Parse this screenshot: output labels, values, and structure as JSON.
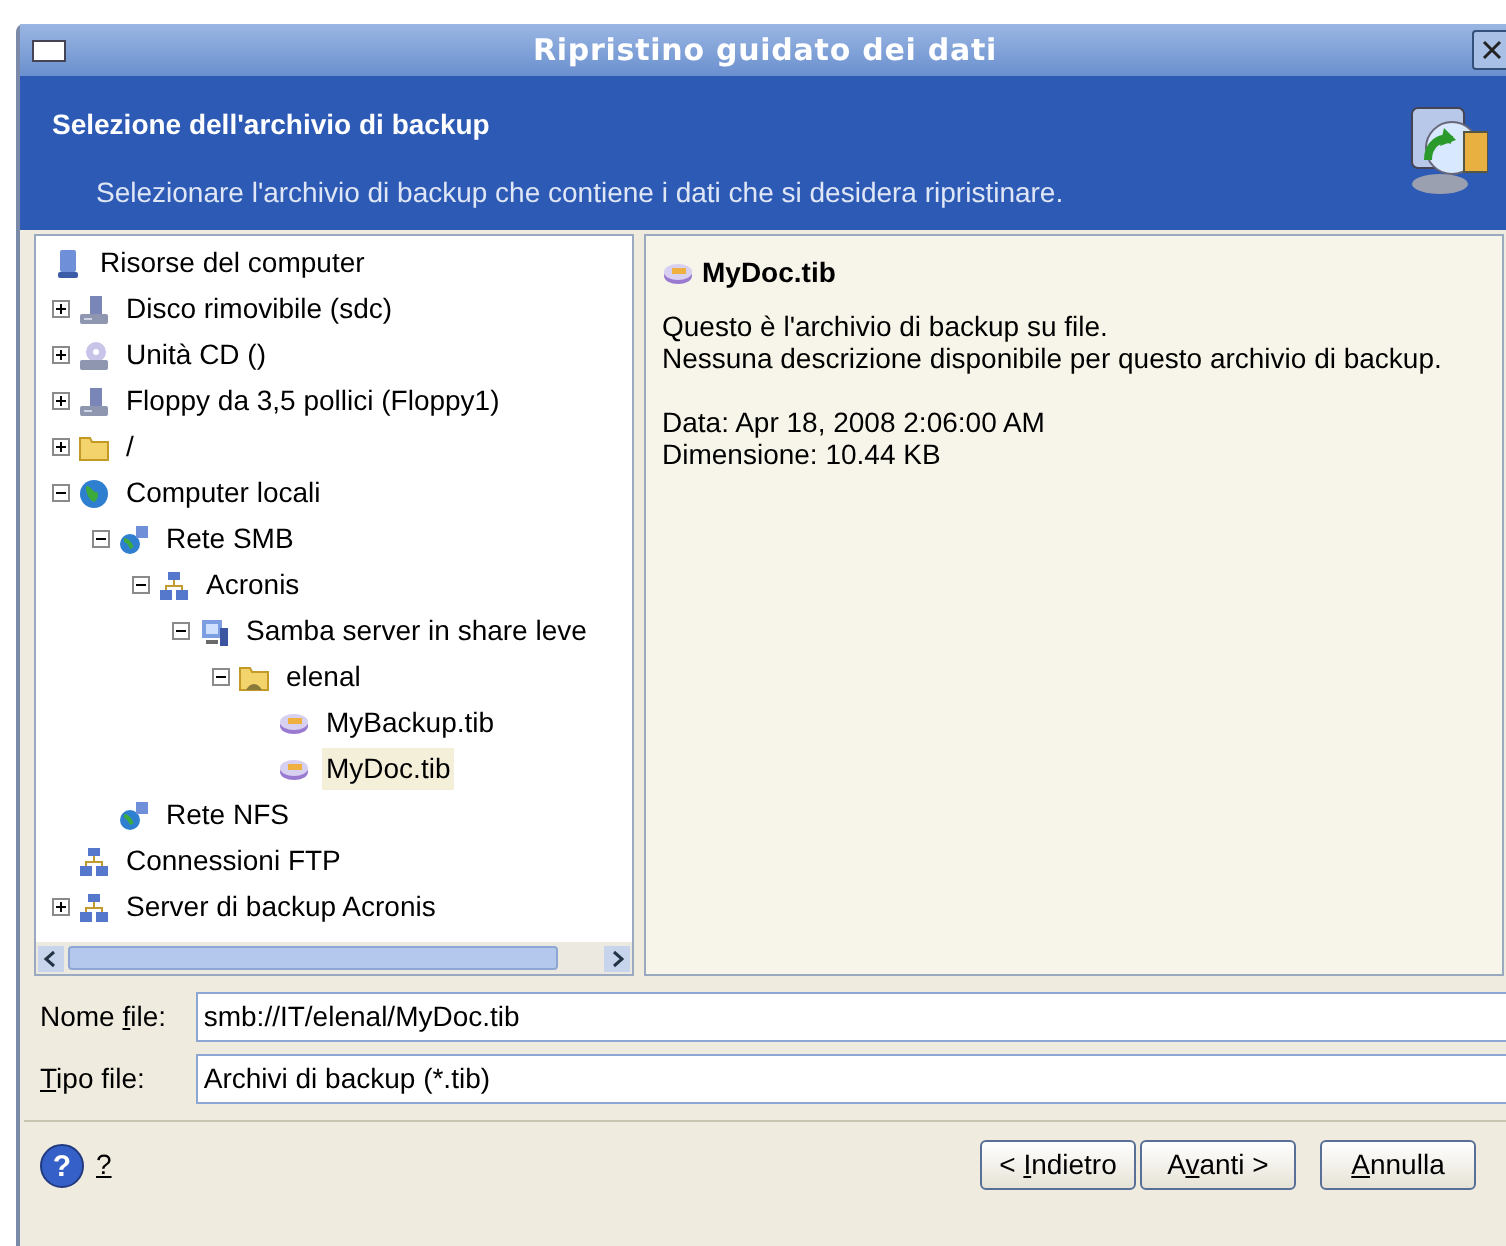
{
  "window": {
    "title": "Ripristino guidato dei dati"
  },
  "header": {
    "title": "Selezione dell'archivio di backup",
    "subtitle": "Selezionare l'archivio di backup che contiene i dati che si desidera ripristinare."
  },
  "tree": {
    "root": {
      "label": "Risorse del computer",
      "kind": "computer",
      "selected": false,
      "children": [
        {
          "label": "Disco rimovibile (sdc)",
          "kind": "drive",
          "expanded": false,
          "selected": false
        },
        {
          "label": "Unità CD ()",
          "kind": "cd",
          "expanded": false,
          "selected": false
        },
        {
          "label": "Floppy da 3,5 pollici (Floppy1)",
          "kind": "drive",
          "expanded": false,
          "selected": false
        },
        {
          "label": "/",
          "kind": "folder",
          "expanded": false,
          "selected": false
        },
        {
          "label": "Computer locali",
          "kind": "globe",
          "expanded": true,
          "selected": false,
          "children": [
            {
              "label": "Rete SMB",
              "kind": "network",
              "expanded": true,
              "selected": false,
              "children": [
                {
                  "label": "Acronis",
                  "kind": "group",
                  "expanded": true,
                  "selected": false,
                  "children": [
                    {
                      "label": "Samba server in share leve",
                      "kind": "server",
                      "expanded": true,
                      "selected": false,
                      "children": [
                        {
                          "label": "elenal",
                          "kind": "share",
                          "expanded": true,
                          "selected": false,
                          "children": [
                            {
                              "label": "MyBackup.tib",
                              "kind": "archive",
                              "selected": false
                            },
                            {
                              "label": "MyDoc.tib",
                              "kind": "archive",
                              "selected": true
                            }
                          ]
                        }
                      ]
                    }
                  ]
                }
              ]
            },
            {
              "label": "Rete NFS",
              "kind": "network",
              "selected": false
            }
          ]
        },
        {
          "label": "Connessioni FTP",
          "kind": "group",
          "selected": false
        },
        {
          "label": "Server di backup Acronis",
          "kind": "group",
          "expanded": false,
          "selected": false
        }
      ]
    }
  },
  "details": {
    "title": "MyDoc.tib",
    "description": [
      "Questo è l'archivio di backup su file.",
      "Nessuna descrizione disponibile per questo archivio di backup."
    ],
    "info": [
      "Data: Apr 18, 2008 2:06:00 AM",
      "Dimensione: 10.44 KB"
    ]
  },
  "fields": [
    {
      "label": {
        "before": "Nome ",
        "key": "f",
        "after": "ile:"
      },
      "value": "smb://IT/elenal/MyDoc.tib"
    },
    {
      "label": {
        "key": "T",
        "after": "ipo file:"
      },
      "value": "Archivi di backup (*.tib)"
    }
  ],
  "help": {
    "icon": "?",
    "label": {
      "key": "?"
    }
  },
  "buttons": [
    {
      "label": {
        "before": "< ",
        "key": "I",
        "after": "ndietro"
      }
    },
    {
      "label": {
        "before": "A",
        "key": "v",
        "after": "anti >"
      }
    },
    {
      "label": {
        "key": "A",
        "after": "nnulla"
      }
    }
  ]
}
